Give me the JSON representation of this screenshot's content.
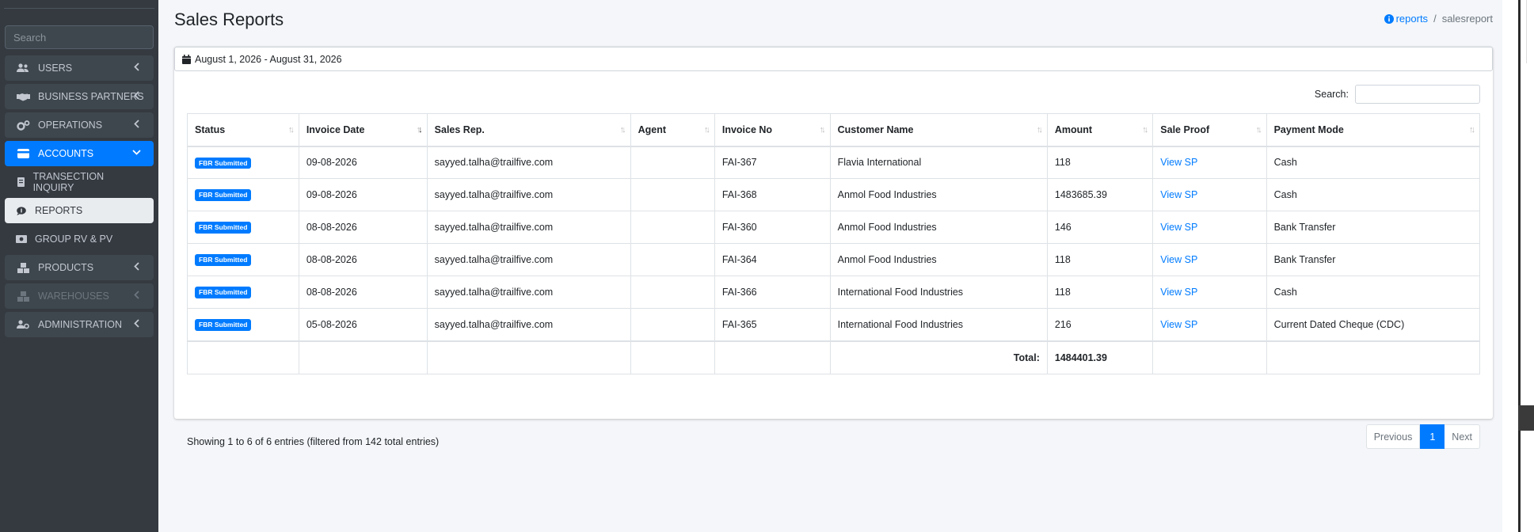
{
  "sidebar": {
    "search_placeholder": "Search",
    "items": [
      {
        "label": "USERS",
        "icon": "users-icon",
        "has_chevron": true
      },
      {
        "label": "BUSINESS PARTNERS",
        "icon": "handshake-icon",
        "has_chevron": true
      },
      {
        "label": "OPERATIONS",
        "icon": "cogs-icon",
        "has_chevron": true
      },
      {
        "label": "ACCOUNTS",
        "icon": "credit-card-icon",
        "has_chevron": true,
        "active": true
      },
      {
        "label": "TRANSECTION INQUIRY",
        "icon": "list-icon",
        "sub": true
      },
      {
        "label": "REPORTS",
        "icon": "comment-dollar-icon",
        "sub": true,
        "selected": true
      },
      {
        "label": "GROUP RV & PV",
        "icon": "money-bill-icon",
        "sub": true
      },
      {
        "label": "PRODUCTS",
        "icon": "cubes-icon",
        "has_chevron": true
      },
      {
        "label": "WAREHOUSES",
        "icon": "cubes-icon",
        "has_chevron": true,
        "disabled": true
      },
      {
        "label": "ADMINISTRATION",
        "icon": "users-cog-icon",
        "has_chevron": true
      }
    ]
  },
  "header": {
    "title": "Sales Reports",
    "breadcrumb": {
      "link": "reports",
      "current": "salesreport"
    }
  },
  "filters": {
    "date_range": "August 1, 2026 - August 31, 2026",
    "search_label": "Search:"
  },
  "table": {
    "columns": [
      "Status",
      "Invoice Date",
      "Sales Rep.",
      "Agent",
      "Invoice No",
      "Customer Name",
      "Amount",
      "Sale Proof",
      "Payment Mode"
    ],
    "rows": [
      {
        "status": "FBR Submitted",
        "invoice_date": "09-08-2026",
        "sales_rep": "sayyed.talha@trailfive.com",
        "agent": "",
        "invoice_no": "FAI-367",
        "customer": "Flavia International",
        "amount": "118",
        "proof": "View SP",
        "payment": "Cash"
      },
      {
        "status": "FBR Submitted",
        "invoice_date": "09-08-2026",
        "sales_rep": "sayyed.talha@trailfive.com",
        "agent": "",
        "invoice_no": "FAI-368",
        "customer": "Anmol Food Industries",
        "amount": "1483685.39",
        "proof": "View SP",
        "payment": "Cash"
      },
      {
        "status": "FBR Submitted",
        "invoice_date": "08-08-2026",
        "sales_rep": "sayyed.talha@trailfive.com",
        "agent": "",
        "invoice_no": "FAI-360",
        "customer": "Anmol Food Industries",
        "amount": "146",
        "proof": "View SP",
        "payment": "Bank Transfer"
      },
      {
        "status": "FBR Submitted",
        "invoice_date": "08-08-2026",
        "sales_rep": "sayyed.talha@trailfive.com",
        "agent": "",
        "invoice_no": "FAI-364",
        "customer": "Anmol Food Industries",
        "amount": "118",
        "proof": "View SP",
        "payment": "Bank Transfer"
      },
      {
        "status": "FBR Submitted",
        "invoice_date": "08-08-2026",
        "sales_rep": "sayyed.talha@trailfive.com",
        "agent": "",
        "invoice_no": "FAI-366",
        "customer": "International Food Industries",
        "amount": "118",
        "proof": "View SP",
        "payment": "Cash"
      },
      {
        "status": "FBR Submitted",
        "invoice_date": "05-08-2026",
        "sales_rep": "sayyed.talha@trailfive.com",
        "agent": "",
        "invoice_no": "FAI-365",
        "customer": "International Food Industries",
        "amount": "216",
        "proof": "View SP",
        "payment": "Current Dated Cheque (CDC)"
      }
    ],
    "total_label": "Total:",
    "total_value": "1484401.39"
  },
  "footer": {
    "info": "Showing 1 to 6 of 6 entries (filtered from 142 total entries)",
    "prev": "Previous",
    "page": "1",
    "next": "Next"
  },
  "colors": {
    "accent": "#007bff",
    "sidebar": "#343a40"
  }
}
